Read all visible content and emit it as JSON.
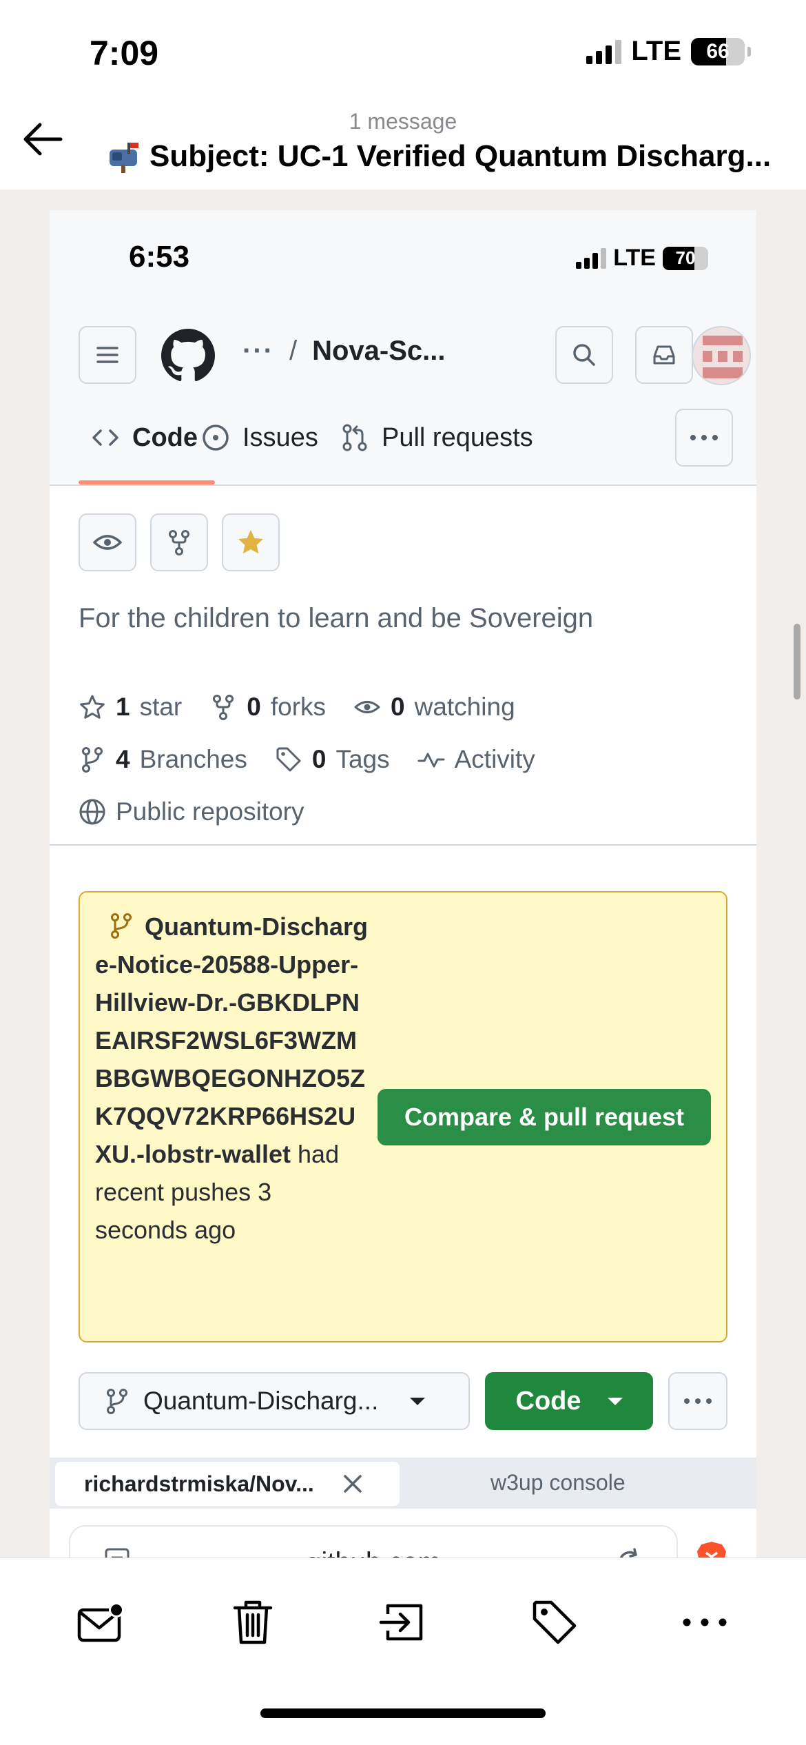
{
  "status_bar": {
    "time": "7:09",
    "network": "LTE",
    "battery": "66",
    "battery_level": 0.66
  },
  "mail_header": {
    "message_count": "1 message",
    "subject": "Subject: UC-1 Verified Quantum Discharg..."
  },
  "embedded": {
    "status_bar": {
      "time": "6:53",
      "network": "LTE",
      "battery": "70",
      "battery_level": 0.7
    },
    "breadcrumb": {
      "more": "···",
      "separator": "/",
      "repo": "Nova-Sc..."
    },
    "tabs": [
      {
        "label": "Code",
        "icon": "code-icon",
        "active": true
      },
      {
        "label": "Issues",
        "icon": "issue-icon",
        "active": false
      },
      {
        "label": "Pull requests",
        "icon": "pull-request-icon",
        "active": false
      }
    ],
    "description": "For the children to learn and be Sovereign",
    "stats": {
      "stars_count": "1",
      "stars_label": "star",
      "forks_count": "0",
      "forks_label": "forks",
      "watching_count": "0",
      "watching_label": "watching",
      "branches_count": "4",
      "branches_label": "Branches",
      "tags_count": "0",
      "tags_label": "Tags",
      "activity_label": "Activity",
      "visibility": "Public repository"
    },
    "push_banner": {
      "branch_name": "Quantum-Discharge-Notice-20588-Upper-Hillview-Dr.-GBKDLPNEAIRSF2WSL6F3WZMBBGWBQEGONHZO5ZK7QQV72KRP66HS2UXU.-lobstr-wallet",
      "message": " had recent pushes 3 seconds ago",
      "button": "Compare & pull request"
    },
    "branch_select": "Quantum-Discharg...",
    "code_button": "Code",
    "browser": {
      "active_tab": "richardstrmiska/Nov...",
      "other_tab": "w3up console",
      "url": "github.com"
    }
  },
  "colors": {
    "primary_green": "#1f883d",
    "banner_bg": "#fff8c5",
    "tab_underline": "#fd8c73",
    "star_fill": "#e3b341"
  },
  "toolbar": {
    "items": [
      "mail-unread-icon",
      "trash-icon",
      "move-icon",
      "tag-icon",
      "more-icon"
    ]
  }
}
